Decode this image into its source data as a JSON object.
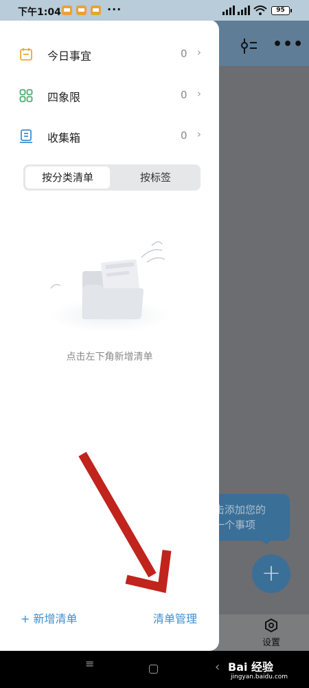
{
  "status_bar": {
    "time": "下午1:04",
    "dots": "···",
    "battery": "95"
  },
  "drawer": {
    "menu": [
      {
        "label": "今日事宜",
        "count": "0",
        "icon": "calendar-icon",
        "color": "#e8a93a"
      },
      {
        "label": "四象限",
        "count": "0",
        "icon": "quadrant-grid-icon",
        "color": "#3fb26f"
      },
      {
        "label": "收集箱",
        "count": "0",
        "icon": "inbox-icon",
        "color": "#3c8fd0"
      }
    ],
    "chevron": "›",
    "segment": {
      "active": "按分类清单",
      "inactive": "按标签"
    },
    "empty_text": "点击左下角新增清单",
    "add_list": "+ 新增清单",
    "manage_list": "清单管理"
  },
  "background": {
    "tip_line1": "击添加您的",
    "tip_line2": "一个事项",
    "fab": "+",
    "settings_label": "设置",
    "more": "•••"
  },
  "nav_bar": {
    "menu": "≡",
    "back": "‹",
    "watermark": "Bai 经验",
    "watermark_sub": "jingyan.baidu.com"
  },
  "colors": {
    "accent": "#3c8fd0",
    "annotation_arrow": "#c0241d"
  }
}
